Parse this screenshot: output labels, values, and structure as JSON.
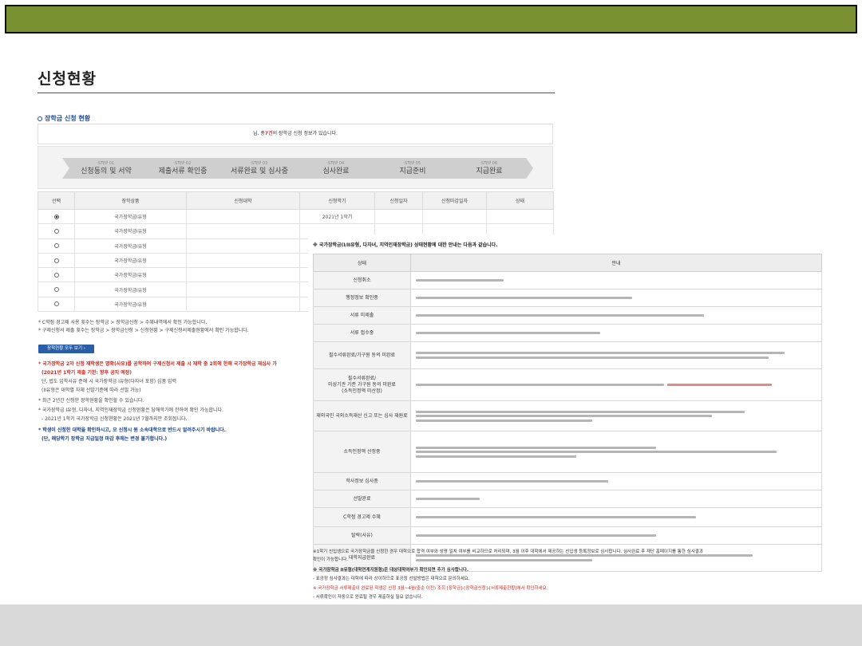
{
  "page": {
    "title": "신청현황",
    "section_title": "장학금 신청 현황"
  },
  "info": {
    "prefix": "님, 총",
    "count": "7건",
    "suffix": "의 장학금 신청 정보가 있습니다."
  },
  "steps": [
    {
      "num": "STEP 01",
      "label": "신청동의 및 서약"
    },
    {
      "num": "STEP 02",
      "label": "제출서류 확인중"
    },
    {
      "num": "STEP 03",
      "label": "서류완료 및 심사중"
    },
    {
      "num": "STEP 04",
      "label": "심사완료"
    },
    {
      "num": "STEP 05",
      "label": "지급준비"
    },
    {
      "num": "STEP 06",
      "label": "지급완료"
    }
  ],
  "app_table": {
    "headers": [
      "선택",
      "장학상품",
      "신청대학",
      "신청학기",
      "신청일자",
      "신청마감일자",
      "상태"
    ],
    "rows": [
      {
        "product": "국가장학금I유형",
        "term": "2021년 1학기",
        "selected": true
      },
      {
        "product": "국가장학금I유형",
        "term": "",
        "selected": false
      },
      {
        "product": "국가장학금I유형",
        "term": "",
        "selected": false
      },
      {
        "product": "국가장학금I유형",
        "term": "",
        "selected": false
      },
      {
        "product": "국가장학금I유형",
        "term": "",
        "selected": false
      },
      {
        "product": "국가장학금I유형",
        "term": "",
        "selected": false
      },
      {
        "product": "국가장학금I유형",
        "term": "",
        "selected": false
      }
    ]
  },
  "notes": {
    "n1": "* C학점 경고제 사용 횟수는 장학금 > 장학금신청 > 수혜내역에서 확인 가능합니다.",
    "n2": "* 구제신청서 제출 횟수는 장학금 > 장학금신청 > 신청현황 > 구제신청서제출현황에서 확인 가능합니다.",
    "btn_all": "장학현황 모두 보기",
    "r1": "* 국가장학금 2차 신청 재학생은 명확(사유)를 공학하여 구제신청서 제출 시 재학 중 2회에 한해 국가장학금 재심사 가",
    "r2": "(2021년 1학기 제출 기한: 향후 공지 예정)",
    "n3": "단, 법도 입학사유 준해 시 국가장학금 I유형(다자녀 포함) 심품 입력",
    "n4": "(II유형은 대학별 자체 선발기준에 따라 선발 가능)",
    "n5": "* 최근 2년간 신청한 장학현황을 확인할 수 있습니다.",
    "n6": "* 국가장학금 I유형, 다자녀, 지역인재장학금 신청현황은 당해학기에 한하여 확인 가능합니다.",
    "n7": "- 2021년 1학기 국가장학금 신청현황은 2021년 7월까지만 조회됩니다.",
    "b1": "* 학생이 신청한 대학을 확인하시고, 오 신청시 원 소속대학으로 반드시 알려주시기 바랍니다.",
    "b2": "(단, 해당학기 장학금 지급일정 마감 후에는 변경 불가합니다.)"
  },
  "status_panel": {
    "title": "※ 국가장학금(I/II유형, 다자녀, 지역인재장학금) 상태현황에 대한 안내는 다음과 같습니다.",
    "headers": [
      "상태",
      "안내"
    ],
    "rows": [
      {
        "status": "신청취소",
        "lines": [
          1
        ]
      },
      {
        "status": "행정정보 확인중",
        "lines": [
          1
        ]
      },
      {
        "status": "서류 미제출",
        "lines": [
          1
        ]
      },
      {
        "status": "서류 접수중",
        "lines": [
          1
        ]
      },
      {
        "status": "필수서류완료/가구원 동의 미완료",
        "lines": [
          1,
          1
        ]
      },
      {
        "status": "필수서류완료/\n미성기관 기준 가구원 동의 미완료\n(소득인정액 미산정)",
        "lines": [
          1
        ]
      },
      {
        "status": "재외국민 국외소득재산 신고 또는 심사 재원료",
        "lines": [
          1,
          1,
          1
        ]
      },
      {
        "status": "소득인정액 산정중",
        "lines": [
          1,
          1,
          1
        ]
      },
      {
        "status": "학사정보 심사중",
        "lines": [
          1
        ]
      },
      {
        "status": "선발완료",
        "lines": [
          1
        ]
      },
      {
        "status": "C학점 경고제 수혜",
        "lines": [
          1
        ]
      },
      {
        "status": "탈락(사유)",
        "lines": [
          1
        ]
      },
      {
        "status": "대학지급완료",
        "lines": [
          1,
          1
        ]
      }
    ],
    "footnotes": [
      "※1학기 신입생으로 국가장학금을 신청한 경우 대학으로 합격 여부와 성명 일치 여부를 비교하므로 처리되며, 3월 이후 대학에서 제공하는 신입생 등록정보로 심사합니다. 심사완료 후 재단 홈페이지를 통한 심사결과",
      "확인이 가능합니다.",
      "※ 국가장학금 II유형(대학연계지원형)은 대상대학여부가 확인되면 추가 심사합니다.",
      "- 표공정 심사결과는 대학에 따라 상이하므로 표공정 선발방법은 대학으로 문의하세요.",
      "※ 국가장학금 서류제출이 완료된 학생은 신청 3월~4월(중순 이전) 조회 [장학금]-[장학금신청]-[서류제출현황]에서 확인하세요.",
      "- 서류확인이 자동으로 완료될 경우 제출하실 필요 없습니다."
    ]
  }
}
